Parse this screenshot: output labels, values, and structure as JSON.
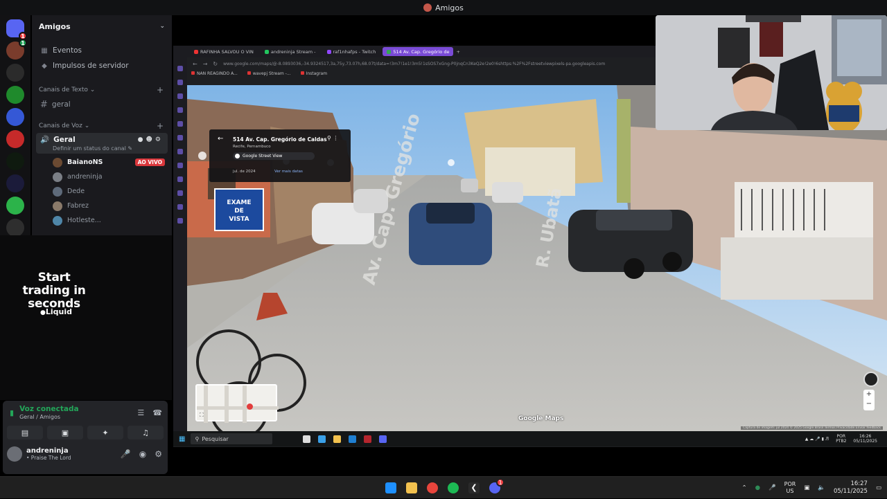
{
  "window": {
    "title": "Amigos"
  },
  "servers": [
    {
      "color": "#5865f2",
      "label": ""
    },
    {
      "color": "#7a3c2c",
      "label": ""
    },
    {
      "color": "#2b2b2b",
      "label": ""
    },
    {
      "color": "#1f8a2c",
      "label": ""
    },
    {
      "color": "#3558d6",
      "label": ""
    },
    {
      "color": "#c62a2a",
      "label": ""
    },
    {
      "color": "#0f1a0f",
      "label": ""
    },
    {
      "color": "#1b1b3a",
      "label": ""
    },
    {
      "color": "#2cb34a",
      "label": ""
    },
    {
      "color": "#2e2e2e",
      "label": ""
    }
  ],
  "badges": {
    "home": "1",
    "server1": "1"
  },
  "sidebar": {
    "header": "Amigos",
    "nav": [
      {
        "label": "Eventos",
        "icon": "calendar-icon"
      },
      {
        "label": "Impulsos de servidor",
        "icon": "boost-icon"
      }
    ],
    "text_category": "Canais de Texto",
    "text_channel": "geral",
    "voice_category": "Canais de Voz",
    "voice_channel": {
      "name": "Geral",
      "status_hint": "Definir um status do canal"
    },
    "voice_users": [
      {
        "name": "BaianoNS",
        "live": "AO VIVO",
        "color": "#6b4a32"
      },
      {
        "name": "andreninja",
        "live": "",
        "color": "#7b7f86"
      },
      {
        "name": "Dede",
        "live": "",
        "color": "#5e6a7a"
      },
      {
        "name": "Fabrez",
        "live": "",
        "color": "#8a7a6a"
      },
      {
        "name": "Hotleste...",
        "live": "",
        "color": "#4f86a8"
      }
    ]
  },
  "ad": {
    "headline": "Start trading in seconds",
    "brand": "Liquid"
  },
  "voice_panel": {
    "title": "Voz conectada",
    "subtitle": "Geral / Amigos",
    "user_name": "andreninja",
    "user_status": "• Praise The Lord"
  },
  "stream": {
    "tabs": [
      {
        "label": "RAFINHA SALVOU O VIN",
        "color": "#e33",
        "active": false
      },
      {
        "label": "andreninja Stream - ",
        "color": "#22c55e",
        "active": false
      },
      {
        "label": "raf1nhafps - Twitch",
        "color": "#9147ff",
        "active": false
      },
      {
        "label": "514 Av. Cap. Gregório de",
        "color": "#34a853",
        "active": true
      }
    ],
    "url": "www.google.com/maps/@-8.0893036,-34.9324517,3a,75y,73.07h,68.07t/data=!3m7!1e1!3m5!1sSOS7xGng-P0jnqCn3KeQ2e!2e0!6shttps:%2F%2Fstreetviewpixels-pa.googleapis.com",
    "bookmarks": [
      "NAN REAGINDO A...",
      "wavepj Stream -...",
      "Instagram"
    ],
    "info_card": {
      "title": "514 Av. Cap. Gregório de Caldas",
      "subtitle": "Recife, Pernambuco",
      "chip": "Google Street View",
      "date": "jul. de 2024",
      "more": "Ver mais datas"
    },
    "maps_logo": "Google Maps",
    "credits": "Captura de imagem: jul 2024 © 2025 Google  Brasil  Termos  Privacidade  Enviar feedback",
    "sign_text": "EXAME DE VISTA",
    "street_labels": [
      "Av. Cap. Gregório",
      "R. Ubatã"
    ],
    "inner_taskbar": {
      "search": "Pesquisar",
      "lang": "POR",
      "lang2": "PTB2",
      "time": "16:26",
      "date": "05/11/2025"
    }
  },
  "host_taskbar": {
    "lang": "POR",
    "lang2": "US",
    "time": "16:27",
    "date": "05/11/2025",
    "discord_badge": "1"
  }
}
